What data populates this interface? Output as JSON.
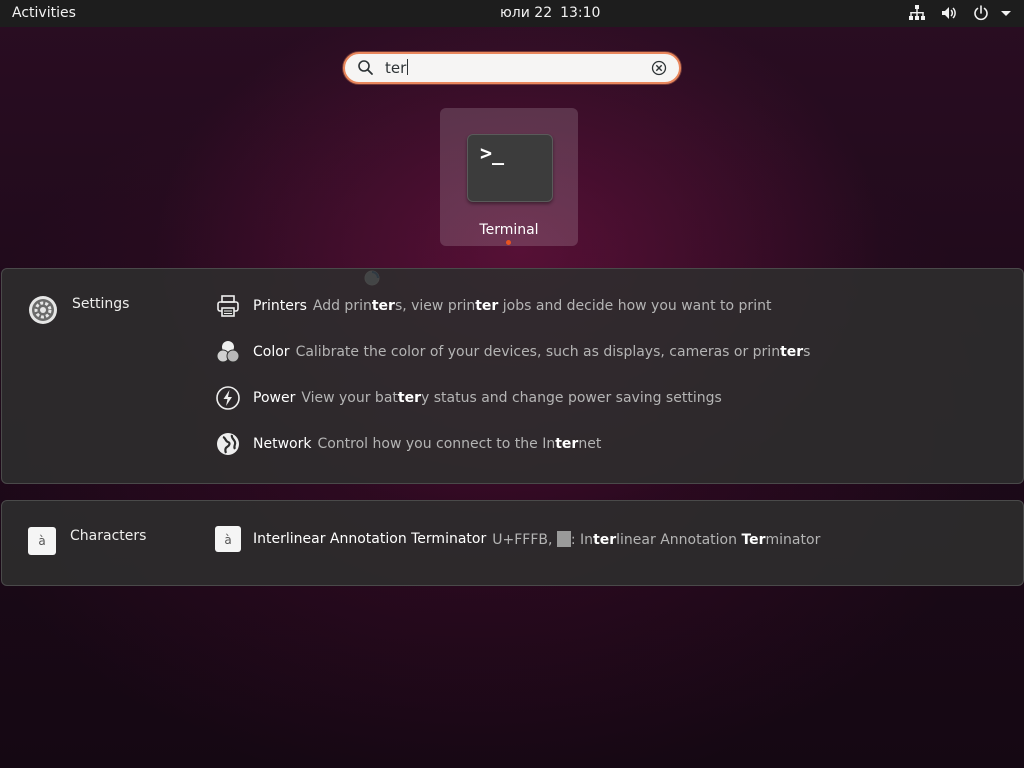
{
  "topbar": {
    "activities": "Activities",
    "date": "юли 22",
    "time": "13:10",
    "tray_icons": [
      "network-icon",
      "volume-icon",
      "power-icon",
      "chevron-down-icon"
    ]
  },
  "search": {
    "query": "ter",
    "icon": "search-icon",
    "clear_icon": "clear-icon"
  },
  "app_results": [
    {
      "label": "Terminal",
      "icon": "terminal-icon",
      "running": true
    }
  ],
  "providers": [
    {
      "name": "Settings",
      "icon": "settings-gear-icon",
      "results": [
        {
          "title": "Printers",
          "icon": "printer-icon",
          "desc_parts": [
            {
              "t": "Add prin",
              "h": false
            },
            {
              "t": "ter",
              "h": true
            },
            {
              "t": "s, view prin",
              "h": false
            },
            {
              "t": "ter",
              "h": true
            },
            {
              "t": " jobs and decide how you want to print",
              "h": false
            }
          ]
        },
        {
          "title": "Color",
          "icon": "color-icon",
          "desc_parts": [
            {
              "t": "Calibrate the color of your devices, such as displays, cameras or prin",
              "h": false
            },
            {
              "t": "ter",
              "h": true
            },
            {
              "t": "s",
              "h": false
            }
          ]
        },
        {
          "title": "Power",
          "icon": "power-bolt-icon",
          "desc_parts": [
            {
              "t": "View your bat",
              "h": false
            },
            {
              "t": "ter",
              "h": true
            },
            {
              "t": "y status and change power saving settings",
              "h": false
            }
          ]
        },
        {
          "title": "Network",
          "icon": "globe-icon",
          "desc_parts": [
            {
              "t": "Control how you connect to the In",
              "h": false
            },
            {
              "t": "ter",
              "h": true
            },
            {
              "t": "net",
              "h": false
            }
          ]
        }
      ]
    },
    {
      "name": "Characters",
      "icon": "characters-icon",
      "icon_glyph": "à",
      "results": [
        {
          "title": "Interlinear Annotation Terminator",
          "icon": "characters-icon",
          "icon_glyph": "à",
          "desc_prefix": "U+FFFB,",
          "desc_parts": [
            {
              "t": ": In",
              "h": false
            },
            {
              "t": "ter",
              "h": true
            },
            {
              "t": "linear Annotation ",
              "h": false
            },
            {
              "t": "Ter",
              "h": true
            },
            {
              "t": "minator",
              "h": false
            }
          ]
        }
      ]
    }
  ],
  "colors": {
    "accent": "#e95420",
    "search_border": "#e9875d",
    "panel_bg": "#2d2d2d",
    "topbar_bg": "#1d1d1d"
  }
}
